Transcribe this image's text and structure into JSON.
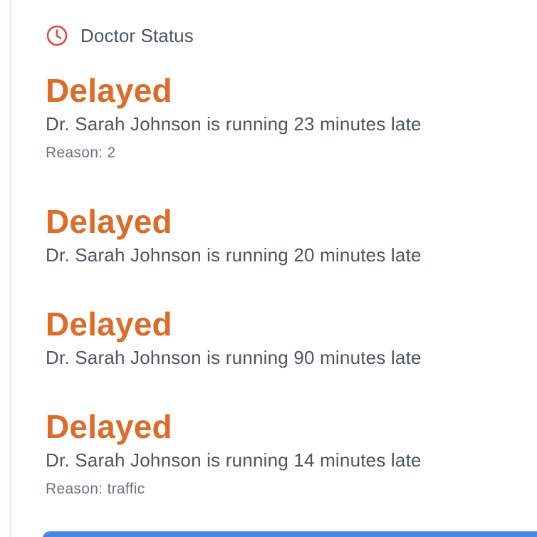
{
  "header": {
    "title": "Doctor Status",
    "icon": "clock-icon",
    "icon_color": "#dc4a4a"
  },
  "entries": [
    {
      "status": "Delayed",
      "message": "Dr. Sarah Johnson is running 23 minutes late",
      "reason": "Reason: 2"
    },
    {
      "status": "Delayed",
      "message": "Dr. Sarah Johnson is running 20 minutes late"
    },
    {
      "status": "Delayed",
      "message": "Dr. Sarah Johnson is running 90 minutes late"
    },
    {
      "status": "Delayed",
      "message": "Dr. Sarah Johnson is running 14 minutes late",
      "reason": "Reason: traffic"
    }
  ],
  "colors": {
    "status": "#dd6b2a",
    "text": "#4b5563",
    "muted": "#6b7280",
    "accent": "#4a86e8"
  }
}
